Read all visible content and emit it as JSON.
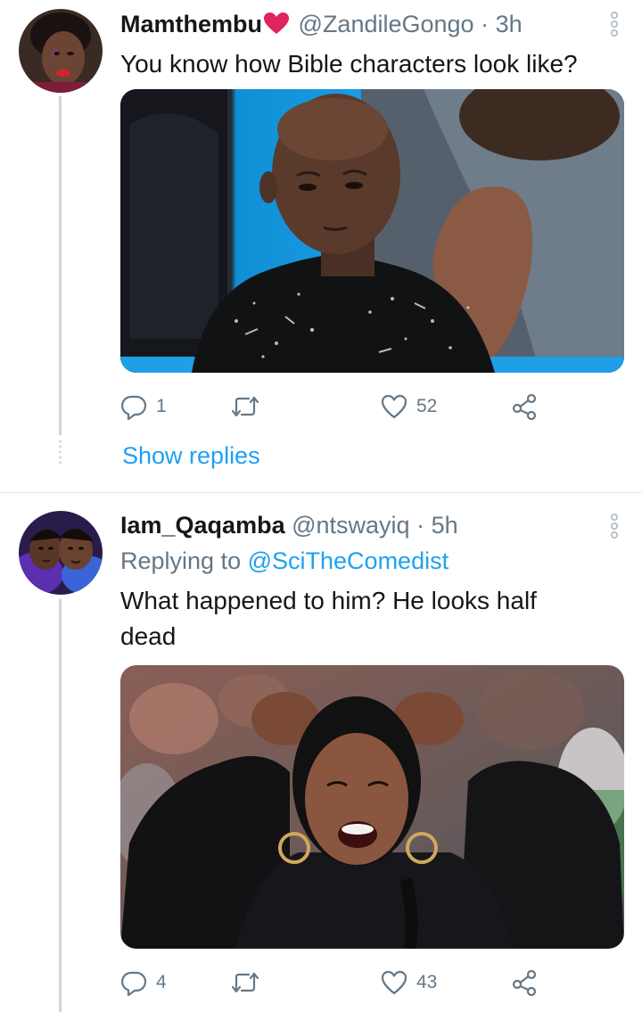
{
  "tweets": [
    {
      "display_name": "Mamthembu",
      "handle": "@ZandileGongo",
      "separator": "·",
      "time": "3h",
      "text": "You know how Bible characters look like?",
      "media_icon": "photo-man-in-sequin-jacket",
      "actions": {
        "replies": "1",
        "retweets": "",
        "likes": "52"
      },
      "show_replies": "Show replies"
    },
    {
      "display_name": "Iam_Qaqamba",
      "handle": "@ntswayiq",
      "separator": "·",
      "time": "5h",
      "replying_prefix": "Replying to",
      "replying_to": "@SciTheComedist",
      "text": "What happened to him? He looks half dead",
      "media_icon": "photo-woman-hands-on-head-laughing",
      "actions": {
        "replies": "4",
        "retweets": "",
        "likes": "43"
      }
    }
  ],
  "colors": {
    "link": "#1da1f2",
    "secondary_text": "#657786",
    "primary_text": "#14171a",
    "heart_emoji": "#e0245e",
    "thread_line": "#ccd6dd"
  }
}
